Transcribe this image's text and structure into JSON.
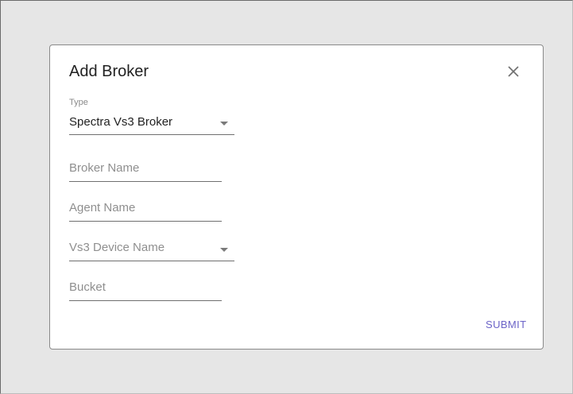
{
  "dialog": {
    "title": "Add Broker",
    "close_icon": "close-icon",
    "submit_label": "SUBMIT"
  },
  "form": {
    "type_label": "Type",
    "type_value": "Spectra Vs3 Broker",
    "broker_name_placeholder": "Broker Name",
    "agent_name_placeholder": "Agent Name",
    "vs3_device_placeholder": "Vs3 Device Name",
    "bucket_placeholder": "Bucket"
  },
  "colors": {
    "accent": "#6b63c7",
    "backdrop": "#e6e6e6"
  }
}
